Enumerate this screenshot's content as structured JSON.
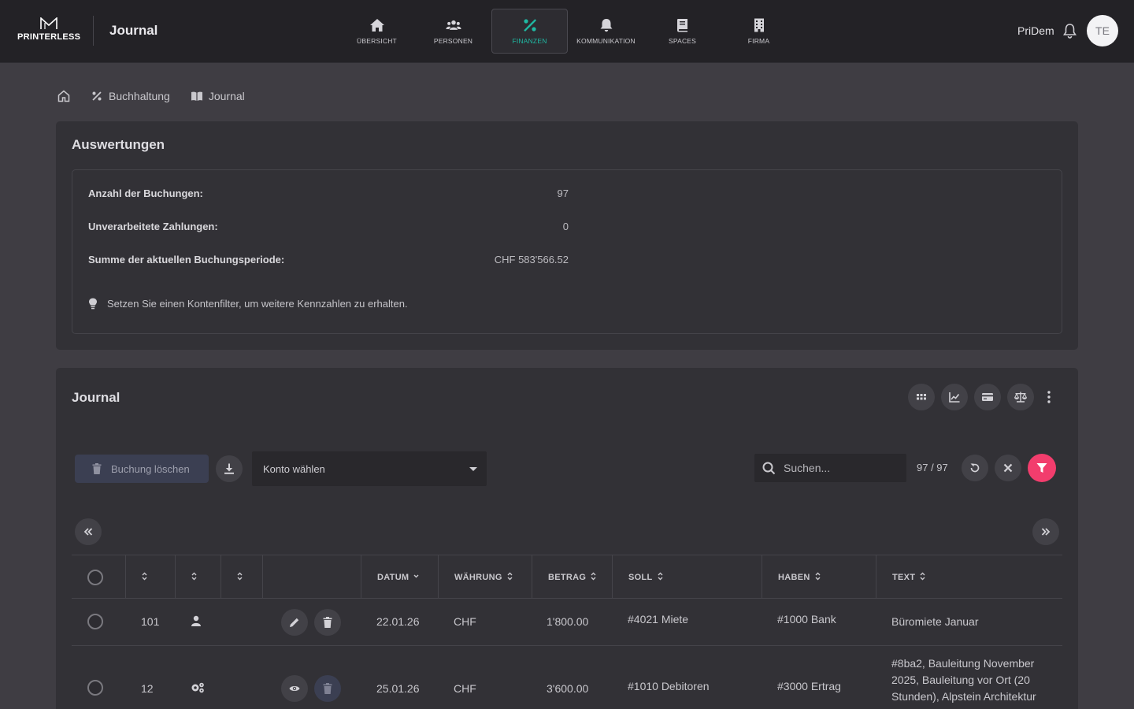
{
  "app": {
    "brand": "PRINTERLESS",
    "title": "Journal",
    "user_name": "PriDem",
    "avatar_initials": "TE",
    "accent_color": "#1fb9a3",
    "filter_color": "#f23d6d"
  },
  "nav": [
    {
      "label": "ÜBERSICHT",
      "icon": "home-icon",
      "active": false
    },
    {
      "label": "PERSONEN",
      "icon": "people-icon",
      "active": false
    },
    {
      "label": "FINANZEN",
      "icon": "percent-icon",
      "active": true
    },
    {
      "label": "KOMMUNIKATION",
      "icon": "bell-icon",
      "active": false
    },
    {
      "label": "SPACES",
      "icon": "book-icon",
      "active": false
    },
    {
      "label": "FIRMA",
      "icon": "building-icon",
      "active": false
    }
  ],
  "breadcrumb": [
    {
      "label": "",
      "icon": "home-icon"
    },
    {
      "label": "Buchhaltung",
      "icon": "percent-icon"
    },
    {
      "label": "Journal",
      "icon": "book-open-icon"
    }
  ],
  "evaluation": {
    "title": "Auswertungen",
    "rows": [
      {
        "label": "Anzahl der Buchungen:",
        "value": "97"
      },
      {
        "label": "Unverarbeitete Zahlungen:",
        "value": "0"
      },
      {
        "label": "Summe der aktuellen Buchungsperiode:",
        "value": "CHF 583'566.52"
      }
    ],
    "hint": "Setzen Sie einen Kontenfilter, um weitere Kennzahlen zu erhalten."
  },
  "journal": {
    "title": "Journal",
    "toolbar_icons": [
      "grid-icon",
      "chart-icon",
      "card-icon",
      "scale-icon",
      "kebab-menu-icon"
    ],
    "delete_label": "Buchung löschen",
    "account_select": "Konto wählen",
    "search_placeholder": "Suchen...",
    "count": "97 / 97",
    "columns": [
      "DATUM",
      "WÄHRUNG",
      "BETRAG",
      "SOLL",
      "HABEN",
      "TEXT"
    ],
    "rows": [
      {
        "id": "101",
        "type_icon": "person-icon",
        "actions": [
          "edit-icon",
          "trash-icon"
        ],
        "datum": "22.01.26",
        "waehrung": "CHF",
        "betrag": "1'800.00",
        "soll": "#4021 Miete",
        "haben": "#1000 Bank",
        "text": "Büromiete Januar"
      },
      {
        "id": "12",
        "type_icon": "gears-icon",
        "actions": [
          "eye-icon",
          "trash-icon"
        ],
        "datum": "25.01.26",
        "waehrung": "CHF",
        "betrag": "3'600.00",
        "soll": "#1010 Debitoren",
        "haben": "#3000 Ertrag",
        "text": "#8ba2, Bauleitung November 2025, Bauleitung vor Ort (20 Stunden), Alpstein Architektur"
      }
    ]
  }
}
